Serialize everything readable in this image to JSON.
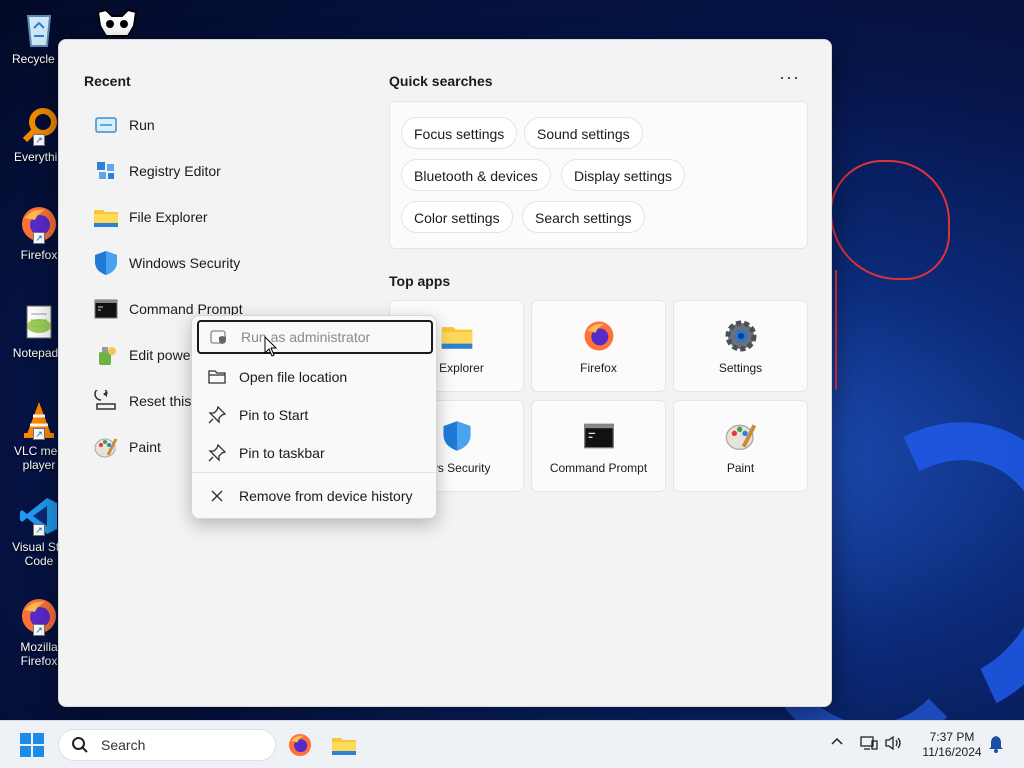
{
  "desktop": {
    "icons": [
      {
        "label": "Recycle B"
      },
      {
        "label": "Everythin"
      },
      {
        "label": "Firefox"
      },
      {
        "label": "Notepad+"
      },
      {
        "label": "VLC med player"
      },
      {
        "label": "Visual Stu Code"
      },
      {
        "label": "Mozilla Firefox"
      }
    ]
  },
  "start_menu": {
    "recent_title": "Recent",
    "recent_items": [
      {
        "label": "Run",
        "icon": "run-icon"
      },
      {
        "label": "Registry Editor",
        "icon": "registry-icon"
      },
      {
        "label": "File Explorer",
        "icon": "folder-icon"
      },
      {
        "label": "Windows Security",
        "icon": "shield-icon"
      },
      {
        "label": "Command Prompt",
        "icon": "terminal-icon"
      },
      {
        "label": "Edit power",
        "icon": "power-plan-icon"
      },
      {
        "label": "Reset this",
        "icon": "reset-icon"
      },
      {
        "label": "Paint",
        "icon": "paint-icon"
      }
    ],
    "quick_searches_title": "Quick searches",
    "more_label": "···",
    "quick_searches": [
      "Focus settings",
      "Sound settings",
      "Bluetooth & devices",
      "Display settings",
      "Color settings",
      "Search settings"
    ],
    "top_apps_title": "Top apps",
    "top_apps": [
      {
        "label": "e Explorer",
        "icon": "folder-icon"
      },
      {
        "label": "Firefox",
        "icon": "firefox-icon"
      },
      {
        "label": "Settings",
        "icon": "gear-icon"
      },
      {
        "label": "ows Security",
        "icon": "shield-icon"
      },
      {
        "label": "Command Prompt",
        "icon": "terminal-icon"
      },
      {
        "label": "Paint",
        "icon": "paint-icon"
      }
    ]
  },
  "context_menu": {
    "items": [
      {
        "label": "Run as administrator",
        "icon": "admin-shield-icon"
      },
      {
        "label": "Open file location",
        "icon": "folder-outline-icon"
      },
      {
        "label": "Pin to Start",
        "icon": "pin-icon"
      },
      {
        "label": "Pin to taskbar",
        "icon": "pin-icon"
      },
      {
        "label": "Remove from device history",
        "icon": "close-icon"
      }
    ]
  },
  "taskbar": {
    "search_placeholder": "Search",
    "time": "7:37 PM",
    "date": "11/16/2024"
  },
  "colors": {
    "accent": "#1d8ce8",
    "menu_bg": "#f3f3f3"
  }
}
